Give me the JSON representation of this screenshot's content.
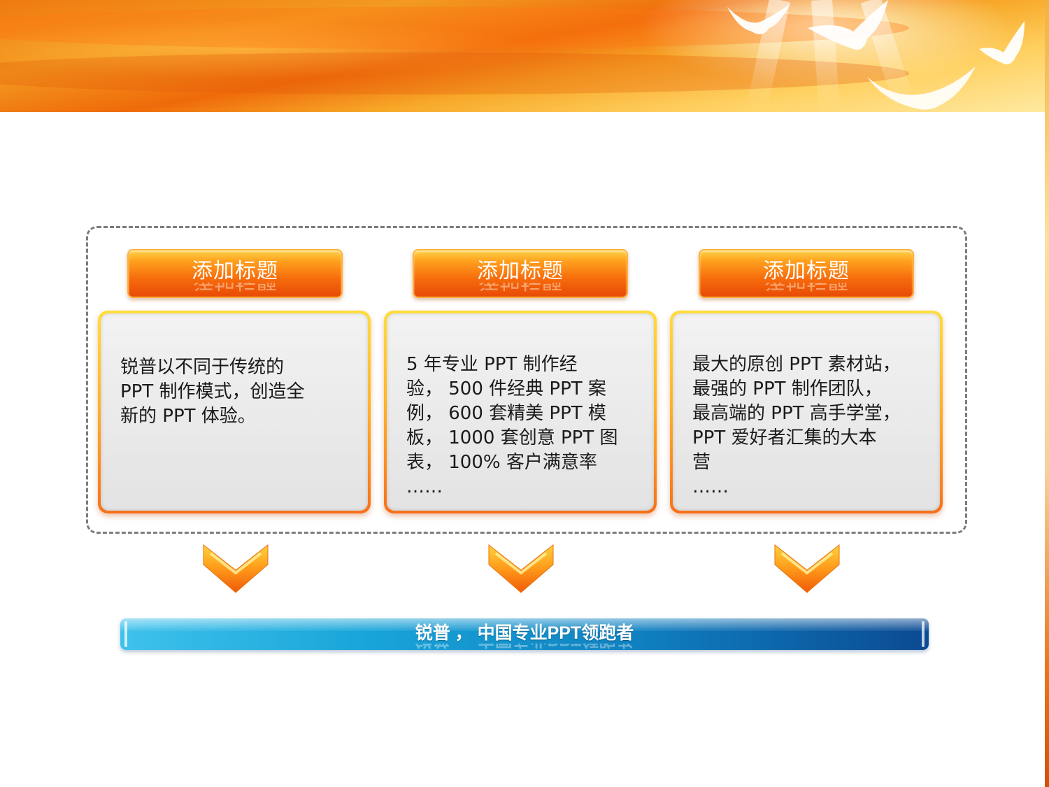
{
  "colors": {
    "banner_orange": "#f07a10",
    "title_button": "#f76d0d",
    "card_border": "#ffb42a",
    "card_fill": "#e8e8e8",
    "slogan_bar_start": "#3fc2ec",
    "slogan_bar_end": "#0b4a93",
    "frame_dash": "#7d7d7d"
  },
  "sections": [
    {
      "title": "添加标题",
      "text": "锐普以不同于传统的\nPPT 制作模式，创造全\n新的 PPT 体验。"
    },
    {
      "title": "添加标题",
      "text": "5 年专业 PPT 制作经\n验，  500 件经典 PPT 案\n例，  600 套精美 PPT 模\n板，  1000 套创意 PPT 图\n表，  100% 客户满意率\n……"
    },
    {
      "title": "添加标题",
      "text": "最大的原创 PPT 素材站，\n最强的 PPT 制作团队，\n最高端的 PPT 高手学堂，\nPPT 爱好者汇集的大本\n营\n……"
    }
  ],
  "icons": {
    "chevron": "chevron-down-icon",
    "dove": "dove-icon"
  },
  "slogan": "锐普 ， 中国专业PPT领跑者"
}
